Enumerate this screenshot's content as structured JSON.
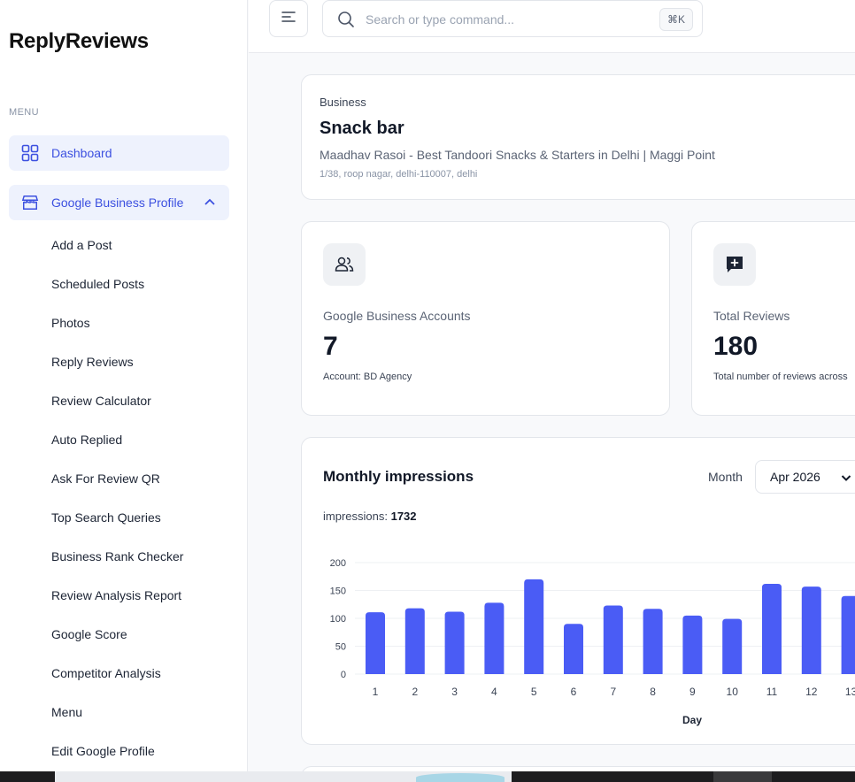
{
  "app": {
    "name": "ReplyReviews"
  },
  "sidebar": {
    "menu_label": "MENU",
    "dashboard": "Dashboard",
    "gbp": "Google Business Profile",
    "sub_items": [
      "Add a Post",
      "Scheduled Posts",
      "Photos",
      "Reply Reviews",
      "Review Calculator",
      "Auto Replied",
      "Ask For Review QR",
      "Top Search Queries",
      "Business Rank Checker",
      "Review Analysis Report",
      "Google Score",
      "Competitor Analysis",
      "Menu",
      "Edit Google Profile"
    ]
  },
  "header": {
    "search_placeholder": "Search or type command...",
    "shortcut": "⌘K"
  },
  "business": {
    "label": "Business",
    "name": "Snack bar",
    "title": "Maadhav Rasoi - Best Tandoori Snacks & Starters in Delhi | Maggi Point",
    "address": "1/38, roop nagar, delhi-110007, delhi"
  },
  "stats": {
    "accounts": {
      "label": "Google Business Accounts",
      "value": "7",
      "sub": "Account: BD Agency"
    },
    "reviews": {
      "label": "Total Reviews",
      "value": "180",
      "sub": "Total number of reviews across"
    }
  },
  "colors": {
    "accent": "#3c50e0",
    "bar": "#4a5cf5"
  },
  "chart_data": {
    "type": "bar",
    "title": "Monthly impressions",
    "month_label": "Month",
    "month_value": "Apr 2026",
    "impressions_label": "impressions:",
    "impressions_total": "1732",
    "xlabel": "Day",
    "ylabel": "",
    "ylim": [
      0,
      200
    ],
    "yticks": [
      0,
      50,
      100,
      150,
      200
    ],
    "grid": true,
    "categories": [
      "1",
      "2",
      "3",
      "4",
      "5",
      "6",
      "7",
      "8",
      "9",
      "10",
      "11",
      "12",
      "13"
    ],
    "values": [
      111,
      118,
      112,
      128,
      170,
      90,
      123,
      117,
      105,
      99,
      162,
      157,
      140
    ]
  }
}
